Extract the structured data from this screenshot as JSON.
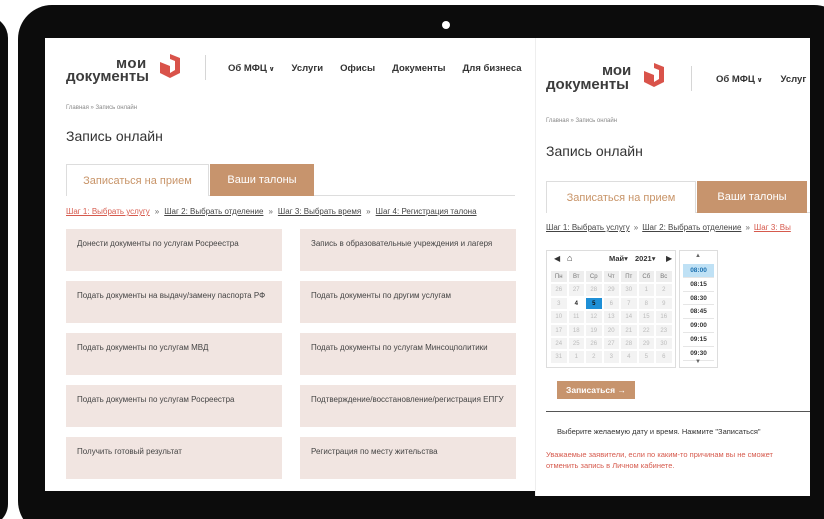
{
  "logo": {
    "line1": "мои",
    "line2": "документы",
    "mark_color": "#d9534a"
  },
  "nav": {
    "about": "Об МФЦ",
    "services": "Услуги",
    "offices": "Офисы",
    "documents": "Документы",
    "business": "Для бизнеса",
    "services_partial": "Услуг"
  },
  "breadcrumb": "Главная » Запись онлайн",
  "page_title": "Запись онлайн",
  "tabs": {
    "book": "Записаться на прием",
    "tickets": "Ваши талоны"
  },
  "steps": {
    "step1": "Шаг 1: Выбрать услугу",
    "step2": "Шаг 2: Выбрать отделение",
    "step3": "Шаг 3: Выбрать время",
    "step4": "Шаг 4: Регистрация талона",
    "step3_partial": "Шаг 3: Вы",
    "separator": "»"
  },
  "services": [
    "Донести документы по услугам Росреестра",
    "Запись в образовательные учреждения и лагеря",
    "Подать документы на выдачу/замену паспорта РФ",
    "Подать документы по другим услугам",
    "Подать документы по услугам МВД",
    "Подать документы по услугам Минсоцполитики",
    "Подать документы по услугам Росреестра",
    "Подтверждение/восстановление/регистрация ЕПГУ",
    "Получить готовый результат",
    "Регистрация по месту жительства"
  ],
  "calendar": {
    "month": "Май",
    "year": "2021",
    "weekdays": [
      "Пн",
      "Вт",
      "Ср",
      "Чт",
      "Пт",
      "Сб",
      "Вс"
    ],
    "days": [
      "26",
      "27",
      "28",
      "29",
      "30",
      "1",
      "2",
      "3",
      "4",
      "5",
      "6",
      "7",
      "8",
      "9",
      "10",
      "11",
      "12",
      "13",
      "14",
      "15",
      "16",
      "17",
      "18",
      "19",
      "20",
      "21",
      "22",
      "23",
      "24",
      "25",
      "26",
      "27",
      "28",
      "29",
      "30",
      "31",
      "1",
      "2",
      "3",
      "4",
      "5",
      "6"
    ],
    "available_index": 8,
    "selected_index": 9
  },
  "times": {
    "slots": [
      "08:00",
      "08:15",
      "08:30",
      "08:45",
      "09:00",
      "09:15",
      "09:30"
    ],
    "selected_index": 0
  },
  "submit_label": "Записаться →",
  "hint": "Выберите желаемую дату и время. Нажмите \"Записаться\"",
  "warning_line1": "Уважаемые заявители, если по каким-то причинам вы не сможет",
  "warning_line2": "отменить запись в Личном кабинете."
}
